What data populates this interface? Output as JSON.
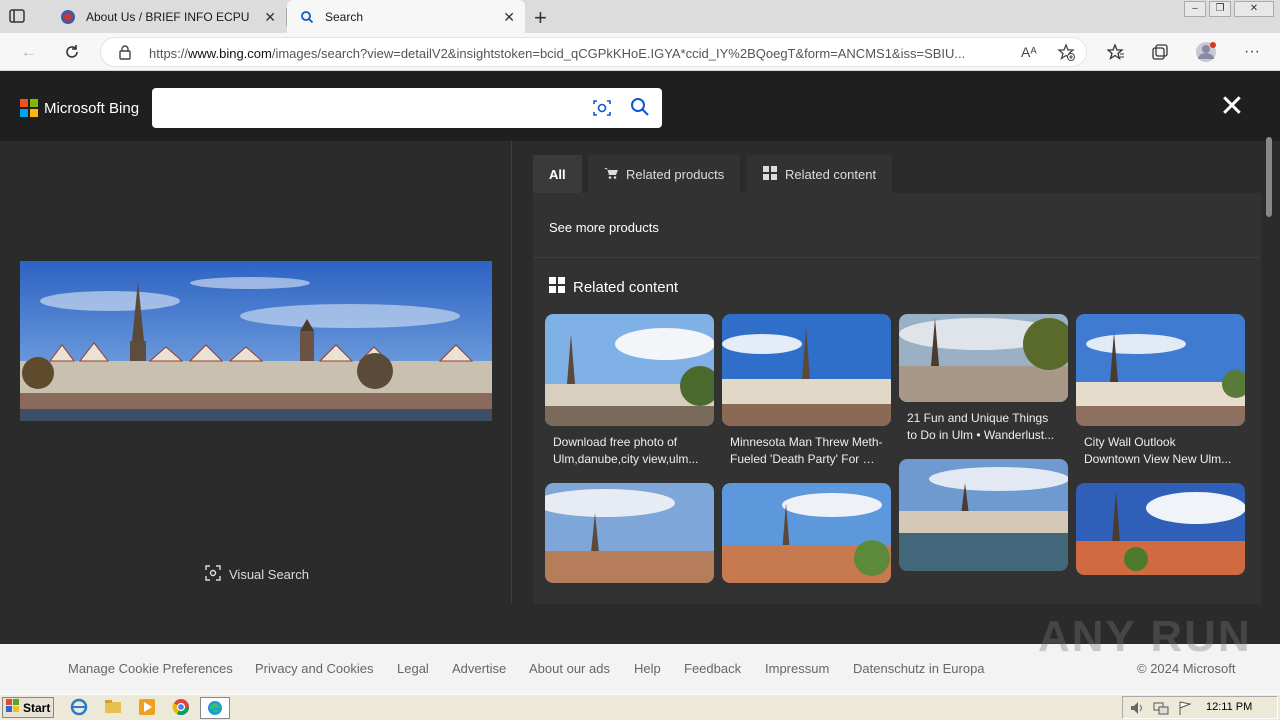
{
  "browser": {
    "tabs": [
      {
        "title": "About Us / BRIEF INFO ECPU",
        "favicon": "shield-crest-icon"
      },
      {
        "title": "Search",
        "favicon": "search-icon"
      }
    ],
    "url_pre": "https://",
    "url_host": "www.bing.com",
    "url_rest": "/images/search?view=detailV2&insightstoken=bcid_qCGPkKHoE.IGYA*ccid_IY%2BQoegT&form=ANCMS1&iss=SBIU...",
    "read_aloud_glyph": "Aᴬ"
  },
  "bing": {
    "logo_text": "Microsoft Bing",
    "search_value": "",
    "visual_search_label": "Visual Search",
    "tabs": [
      "All",
      "Related products",
      "Related content"
    ],
    "see_more": "See more products",
    "related_header": "Related content",
    "cards": [
      {
        "lines": [
          "Download free photo of",
          "Ulm,danube,city view,ulm..."
        ]
      },
      {
        "lines": [
          "Minnesota Man Threw Meth-",
          "Fueled 'Death Party' For Hi..."
        ]
      },
      {
        "lines": [
          "21 Fun and Unique Things",
          "to Do in Ulm • Wanderlust..."
        ]
      },
      {
        "lines": [
          "City Wall Outlook",
          "Downtown View New Ulm..."
        ]
      },
      {
        "lines": []
      },
      {
        "lines": []
      },
      {
        "lines": []
      },
      {
        "lines": []
      }
    ]
  },
  "footer": {
    "links": [
      "Manage Cookie Preferences",
      "Privacy and Cookies",
      "Legal",
      "Advertise",
      "About our ads",
      "Help",
      "Feedback",
      "Impressum",
      "Datenschutz in Europa"
    ],
    "copyright": "© 2024 Microsoft"
  },
  "watermark": "ANY RUN",
  "taskbar": {
    "start_label": "Start",
    "clock": "12:11 PM"
  },
  "colors": {
    "bing_dark": "#2b2b2b",
    "header_dark": "#1f1f1f",
    "search_icon_blue": "#0b57d0"
  }
}
